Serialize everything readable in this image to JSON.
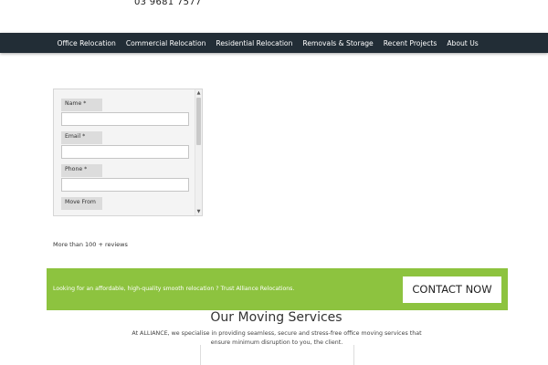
{
  "header": {
    "phone": "03 9681 7577"
  },
  "nav": {
    "items": [
      {
        "label": "Office Relocation"
      },
      {
        "label": "Commercial Relocation"
      },
      {
        "label": "Residential Relocation"
      },
      {
        "label": "Removals & Storage"
      },
      {
        "label": "Recent Projects"
      },
      {
        "label": "About Us"
      }
    ]
  },
  "form": {
    "fields": [
      {
        "label": "Name *",
        "value": ""
      },
      {
        "label": "Email *",
        "value": ""
      },
      {
        "label": "Phone *",
        "value": ""
      },
      {
        "label": "Move From",
        "value": ""
      }
    ],
    "scroll_up_icon": "up-arrow-icon",
    "scroll_down_icon": "down-arrow-icon"
  },
  "reviews": {
    "text": "More than 100 + reviews"
  },
  "cta": {
    "text": "Looking for an affordable, high-quality smooth relocation ? Trust Alliance Relocations.",
    "button_label": "CONTACT NOW",
    "background_color": "#8dc33f"
  },
  "services": {
    "title": "Our Moving Services",
    "description": "At ALLIANCE, we specialise in providing seamless, secure and stress-free office moving services that ensure minimum disruption to you, the client."
  },
  "colors": {
    "nav_background": "#222d36",
    "accent_green": "#8dc33f"
  }
}
